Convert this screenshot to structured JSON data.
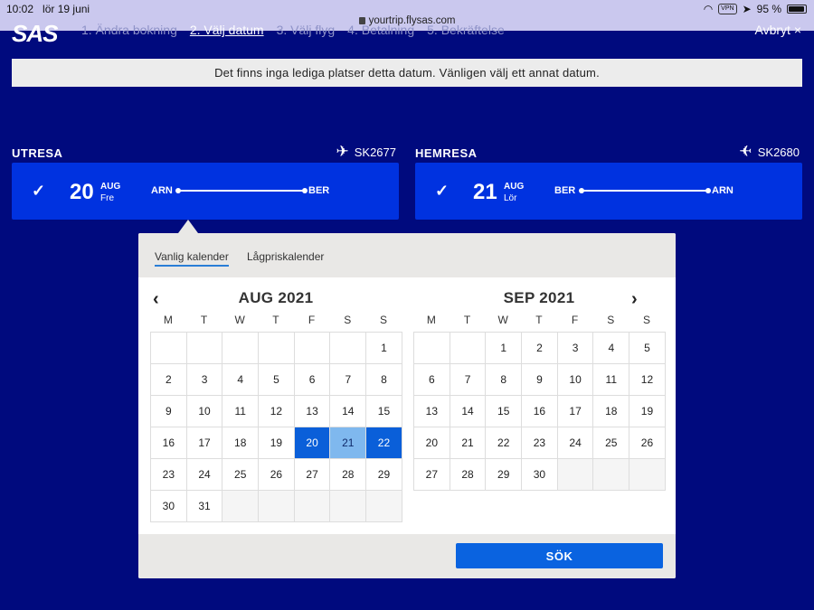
{
  "statusbar": {
    "time": "10:02",
    "date": "lör 19 juni",
    "url": "yourtrip.flysas.com",
    "vpn": "VPN",
    "battery": "95 %"
  },
  "header": {
    "logo": "SAS",
    "steps": [
      "1. Ändra bokning",
      "2. Välj datum",
      "3. Välj flyg",
      "4. Betalning",
      "5. Bekräftelse"
    ],
    "abort": "Avbryt ×"
  },
  "alert": "Det finns inga lediga platser detta datum. Vänligen välj ett annat datum.",
  "outbound": {
    "title": "UTRESA",
    "flight": "SK2677",
    "day": "20",
    "month": "AUG",
    "weekday": "Fre",
    "from": "ARN",
    "to": "BER"
  },
  "return": {
    "title": "HEMRESA",
    "flight": "SK2680",
    "day": "21",
    "month": "AUG",
    "weekday": "Lör",
    "from": "BER",
    "to": "ARN"
  },
  "calendar": {
    "tabs": [
      "Vanlig kalender",
      "Lågpriskalender"
    ],
    "weekdays": [
      "M",
      "T",
      "W",
      "T",
      "F",
      "S",
      "S"
    ],
    "months": [
      {
        "title": "AUG 2021",
        "offset": 6,
        "days": 31,
        "selected": [
          20,
          22
        ],
        "range": [
          21
        ]
      },
      {
        "title": "SEP 2021",
        "offset": 2,
        "days": 30,
        "selected": [],
        "range": []
      }
    ],
    "search_label": "SÖK"
  }
}
